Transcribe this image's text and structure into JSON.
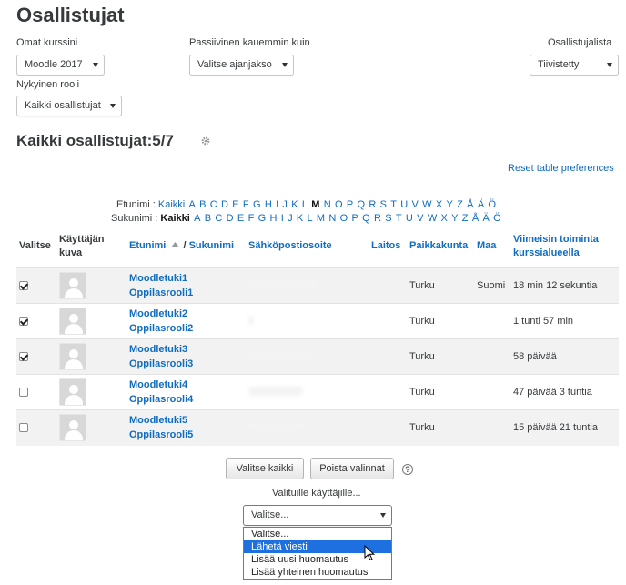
{
  "page": {
    "title": "Osallistujat"
  },
  "filters": {
    "courses_label": "Omat kurssini",
    "courses_value": "Moodle 2017",
    "inactive_label": "Passiivinen kauemmin kuin",
    "inactive_value": "Valitse ajanjakso",
    "list_label": "Osallistujalista",
    "list_value": "Tiivistetty",
    "role_label": "Nykyinen rooli",
    "role_value": "Kaikki osallistujat"
  },
  "summary": {
    "heading": "Kaikki osallistujat:5/7",
    "reset_link": "Reset table preferences"
  },
  "initials": {
    "firstname_label": "Etunimi :",
    "surname_label": "Sukunimi :",
    "all": "Kaikki",
    "letters": [
      "A",
      "B",
      "C",
      "D",
      "E",
      "F",
      "G",
      "H",
      "I",
      "J",
      "K",
      "L",
      "M",
      "N",
      "O",
      "P",
      "Q",
      "R",
      "S",
      "T",
      "U",
      "V",
      "W",
      "X",
      "Y",
      "Z",
      "Å",
      "Ä",
      "Ö"
    ],
    "firstname_selected": "M",
    "surname_selected": "Kaikki"
  },
  "table": {
    "headers": {
      "select": "Valitse",
      "picture": "Käyttäjän kuva",
      "firstname": "Etunimi",
      "separator": "/",
      "surname": "Sukunimi",
      "email": "Sähköpostiosoite",
      "department": "Laitos",
      "city": "Paikkakunta",
      "country": "Maa",
      "lastaccess": "Viimeisin toiminta kurssialueella"
    },
    "rows": [
      {
        "first": "Moodletuki1",
        "last": "Oppilasrooli1",
        "city": "Turku",
        "country": "Suomi",
        "lastaccess": "18 min 12 sekuntia",
        "checked": true
      },
      {
        "first": "Moodletuki2",
        "last": "Oppilasrooli2",
        "city": "Turku",
        "country": "",
        "lastaccess": "1 tunti 57 min",
        "checked": true
      },
      {
        "first": "Moodletuki3",
        "last": "Oppilasrooli3",
        "city": "Turku",
        "country": "",
        "lastaccess": "58 päivää",
        "checked": true
      },
      {
        "first": "Moodletuki4",
        "last": "Oppilasrooli4",
        "city": "Turku",
        "country": "",
        "lastaccess": "47 päivää 3 tuntia",
        "checked": false
      },
      {
        "first": "Moodletuki5",
        "last": "Oppilasrooli5",
        "city": "Turku",
        "country": "",
        "lastaccess": "15 päivää 21 tuntia",
        "checked": false
      }
    ]
  },
  "actions": {
    "select_all": "Valitse kaikki",
    "deselect_all": "Poista valinnat",
    "help": "?",
    "with_selected_label": "Valituille käyttäjille...",
    "with_selected_value": "Valitse...",
    "options": [
      "Valitse...",
      "Lähetä viesti",
      "Lisää uusi huomautus",
      "Lisää yhteinen huomautus"
    ],
    "highlighted_option": 1
  },
  "icons": {
    "gear": "gear-icon",
    "sort": "sort-asc-icon",
    "caret": "chevron-down-icon",
    "cursor": "mouse-pointer-icon",
    "avatar": "default-user-icon"
  },
  "colors": {
    "link": "#0f6cbf",
    "highlight": "#1e70e0",
    "row_odd": "#f2f2f2"
  }
}
